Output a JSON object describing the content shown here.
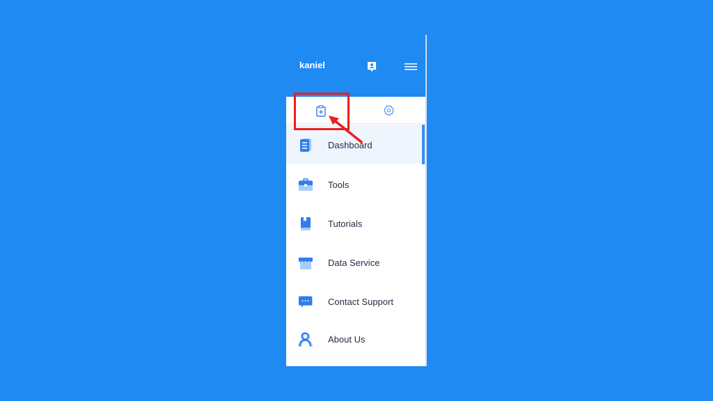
{
  "header": {
    "username": "kaniel",
    "badge_icon": "user-badge-icon",
    "menu_icon": "hamburger-menu-icon"
  },
  "tabs": [
    {
      "name": "clipboard-add",
      "icon": "clipboard-plus-icon",
      "selected": true
    },
    {
      "name": "settings",
      "icon": "gear-icon",
      "selected": false
    }
  ],
  "menu": {
    "items": [
      {
        "label": "Dashboard",
        "icon": "document-icon",
        "active": true
      },
      {
        "label": "Tools",
        "icon": "toolbox-icon",
        "active": false
      },
      {
        "label": "Tutorials",
        "icon": "book-icon",
        "active": false
      },
      {
        "label": "Data Service",
        "icon": "storefront-icon",
        "active": false
      },
      {
        "label": "Contact Support",
        "icon": "chat-bubble-icon",
        "active": false
      },
      {
        "label": "About Us",
        "icon": "person-icon",
        "active": false
      }
    ]
  },
  "annotation": {
    "target": "clipboard-add tab",
    "color": "#ee1c1c"
  },
  "colors": {
    "background": "#1f8af2",
    "accent": "#3a8ef0",
    "active_item_bg": "#eef5fd",
    "text": "#2a2a44"
  }
}
